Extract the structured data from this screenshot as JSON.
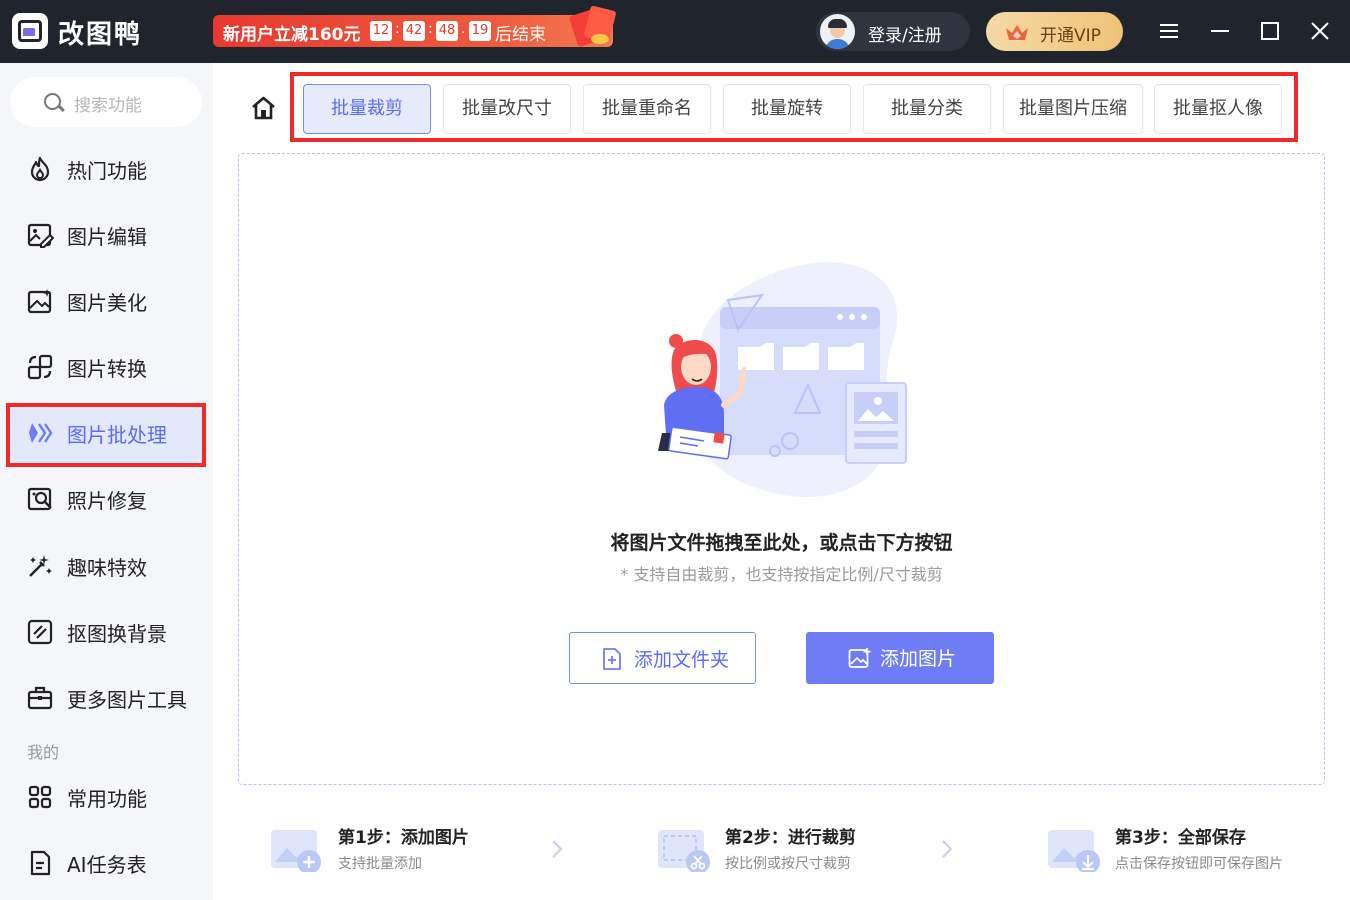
{
  "titlebar": {
    "app_name": "改图鸭",
    "promo": {
      "text": "新用户立减160元",
      "countdown": [
        "12",
        "42",
        "48",
        "19"
      ],
      "suffix": "后结束"
    },
    "login_label": "登录/注册",
    "vip_label": "开通VIP",
    "controls": [
      "menu-icon",
      "minimize-icon",
      "maximize-icon",
      "close-icon"
    ]
  },
  "sidebar": {
    "search_placeholder": "搜索功能",
    "items": [
      {
        "label": "热门功能",
        "icon": "fire-icon"
      },
      {
        "label": "图片编辑",
        "icon": "image-edit-icon"
      },
      {
        "label": "图片美化",
        "icon": "image-beautify-icon"
      },
      {
        "label": "图片转换",
        "icon": "convert-icon"
      },
      {
        "label": "图片批处理",
        "icon": "batch-icon",
        "active": true
      },
      {
        "label": "照片修复",
        "icon": "photo-repair-icon"
      },
      {
        "label": "趣味特效",
        "icon": "magic-wand-icon"
      },
      {
        "label": "抠图换背景",
        "icon": "cutout-icon"
      },
      {
        "label": "更多图片工具",
        "icon": "toolbox-icon"
      }
    ],
    "section_mine": "我的",
    "mine_items": [
      {
        "label": "常用功能",
        "icon": "grid-icon"
      },
      {
        "label": "AI任务表",
        "icon": "document-icon"
      }
    ]
  },
  "tabs": [
    {
      "label": "批量裁剪",
      "active": true
    },
    {
      "label": "批量改尺寸"
    },
    {
      "label": "批量重命名"
    },
    {
      "label": "批量旋转"
    },
    {
      "label": "批量分类"
    },
    {
      "label": "批量图片压缩"
    },
    {
      "label": "批量抠人像"
    }
  ],
  "dropzone": {
    "title": "将图片文件拖拽至此处，或点击下方按钮",
    "subtitle": "* 支持自由裁剪，也支持按指定比例/尺寸裁剪",
    "add_folder": "添加文件夹",
    "add_image": "添加图片"
  },
  "steps": [
    {
      "title": "第1步：添加图片",
      "desc": "支持批量添加"
    },
    {
      "title": "第2步：进行裁剪",
      "desc": "按比例或按尺寸裁剪"
    },
    {
      "title": "第3步：全部保存",
      "desc": "点击保存按钮即可保存图片"
    }
  ],
  "colors": {
    "accent": "#6e7cf6",
    "titlebar_bg": "#20242d",
    "highlight_border": "#ee2a2a",
    "sidebar_bg": "#f5f6fa"
  }
}
